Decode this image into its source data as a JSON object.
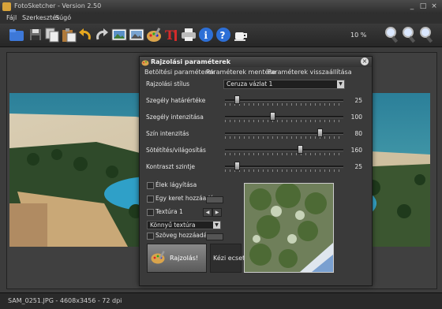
{
  "window": {
    "title": "FotoSketcher - Version 2.50",
    "minimize": "_",
    "maximize": "□",
    "close": "×"
  },
  "menu": [
    {
      "label": "Fájl"
    },
    {
      "label": "Szerkesztés"
    },
    {
      "label": "Súgó"
    }
  ],
  "toolbar": {
    "icons": [
      "open-folder-icon",
      "save-icon",
      "copy-icon",
      "paste-icon",
      "undo-icon",
      "redo-icon",
      "original-image-icon",
      "result-image-icon",
      "palette-icon",
      "text-tool-icon",
      "print-icon",
      "info-icon",
      "help-icon",
      "coffee-icon",
      "zoom-in-icon",
      "zoom-fit-icon",
      "zoom-out-icon"
    ],
    "zoom_level": "10 %"
  },
  "status": {
    "text": "SAM_0251.JPG - 4608x3456 - 72 dpi"
  },
  "dialog": {
    "title": "Rajzolási paraméterek",
    "menu": [
      "Betöltési paraméterek",
      "Paraméterek mentése",
      "Paraméterek visszaállítása"
    ],
    "style_label": "Rajzolási stílus",
    "style_value": "Ceruza vázlat 1",
    "sliders": [
      {
        "label": "Szegély határértéke",
        "value": "25",
        "fraction": 0.1
      },
      {
        "label": "Szegély intenzitása",
        "value": "100",
        "fraction": 0.4
      },
      {
        "label": "Szín intenzitás",
        "value": "80",
        "fraction": 0.8
      },
      {
        "label": "Sötétítés/világosítás",
        "value": "160",
        "fraction": 0.63
      },
      {
        "label": "Kontraszt szintje",
        "value": "25",
        "fraction": 0.1
      }
    ],
    "checkboxes": [
      {
        "label": "Élek lágyítása"
      },
      {
        "label": "Egy keret hozzáadása"
      },
      {
        "label": "Textúra 1"
      },
      {
        "label": "Szöveg hozzáadása"
      }
    ],
    "texture_value": "Könnyű textúra",
    "render_button": "Rajzolás!",
    "brush_button": "Kézi ecset"
  }
}
